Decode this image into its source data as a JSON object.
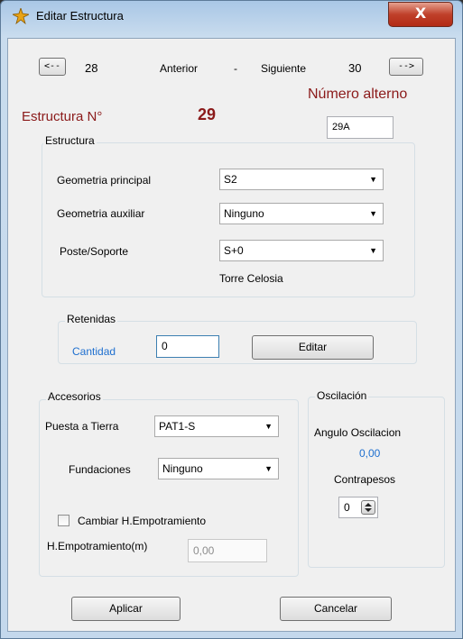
{
  "window": {
    "title": "Editar Estructura",
    "close_label": "X"
  },
  "nav": {
    "prev_button": "<--",
    "prev_number": "28",
    "anterior": "Anterior",
    "separator": "-",
    "siguiente": "Siguiente",
    "next_number": "30",
    "next_button": "-->"
  },
  "estructura_header": {
    "label": "Estructura N°",
    "number": "29",
    "alt_label": "Número alterno",
    "alt_value": "29A"
  },
  "estructura_group": {
    "title": "Estructura",
    "geometria_principal_label": "Geometria principal",
    "geometria_principal_value": "S2",
    "geometria_auxiliar_label": "Geometria auxiliar",
    "geometria_auxiliar_value": "Ninguno",
    "poste_label": "Poste/Soporte",
    "poste_value": "S+0",
    "poste_desc": "Torre Celosia"
  },
  "retenidas": {
    "title": "Retenidas",
    "cantidad_label": "Cantidad",
    "cantidad_value": "0",
    "editar_button": "Editar"
  },
  "accesorios": {
    "title": "Accesorios",
    "puesta_tierra_label": "Puesta a Tierra",
    "puesta_tierra_value": "PAT1-S",
    "fundaciones_label": "Fundaciones",
    "fundaciones_value": "Ninguno",
    "cambiar_label": "Cambiar H.Empotramiento",
    "cambiar_checked": false,
    "hemp_label": "H.Empotramiento(m)",
    "hemp_value": "0,00"
  },
  "oscilacion": {
    "title": "Oscilación",
    "angulo_label": "Angulo Oscilacion",
    "angulo_value": "0,00",
    "contrapesos_label": "Contrapesos",
    "contrapesos_value": "0"
  },
  "footer": {
    "aplicar": "Aplicar",
    "cancelar": "Cancelar"
  },
  "colors": {
    "accent_red": "#8b1a1a",
    "value_blue": "#1e6fcf"
  }
}
